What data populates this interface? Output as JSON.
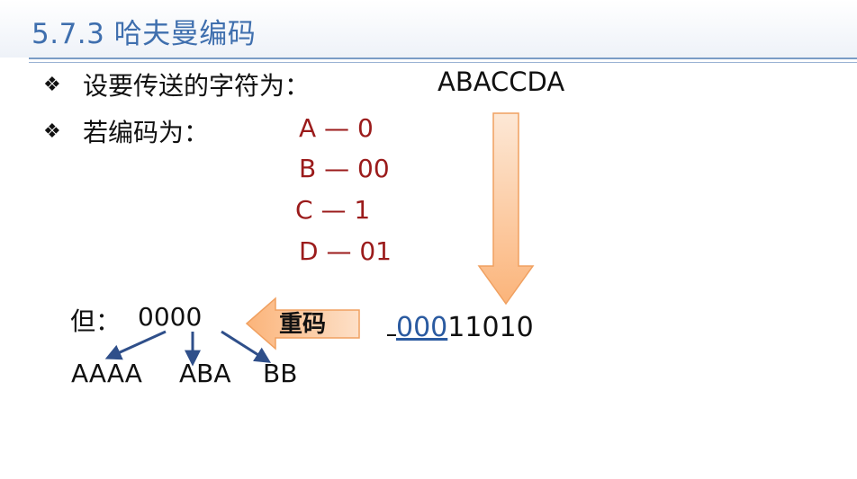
{
  "title": "5.7.3 哈夫曼编码",
  "bullets": [
    {
      "marker": "❖",
      "text": "设要传送的字符为："
    },
    {
      "marker": "❖",
      "text": "若编码为："
    }
  ],
  "message": "ABACCDA",
  "codes": [
    {
      "text": "A — 0"
    },
    {
      "text": "B — 00"
    },
    {
      "text": "C  — 1"
    },
    {
      "text": "D — 01"
    }
  ],
  "encoded": {
    "underlined": "000",
    "rest": "11010"
  },
  "arrow_label": "重码",
  "but_label": "但：",
  "ambiguous_code": "0000",
  "decodings": [
    "AAAA",
    "ABA",
    "BB"
  ],
  "colors": {
    "title": "#3f6fae",
    "code_text": "#9b1b1b",
    "arrow_fill": "#fbc39a",
    "arrow_stroke": "#f0a060",
    "decode_arrow": "#2f4f8a"
  }
}
